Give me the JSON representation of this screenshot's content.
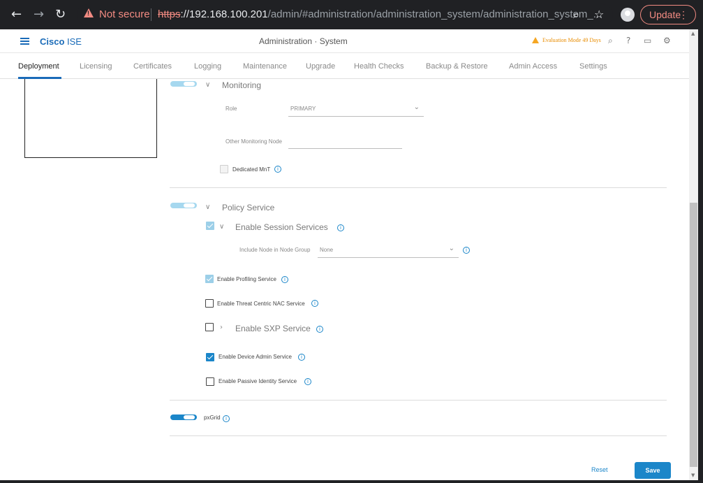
{
  "browser": {
    "not_secure": "Not secure",
    "url_scheme": "https",
    "url_host": "://192.168.100.201",
    "url_path": "/admin/#administration/administration_system/administration_system_...",
    "update_label": "Update",
    "icons": [
      "back-arrow",
      "forward-arrow",
      "reload",
      "zoom",
      "star",
      "profile",
      "more-vertical"
    ]
  },
  "header": {
    "brand_bold": "Cisco",
    "brand_rest": " ISE",
    "title": "Administration · System",
    "evaluation": "Evaluation Mode 49 Days",
    "icons": [
      "search-icon",
      "help-icon",
      "dashboard-icon",
      "settings-icon"
    ]
  },
  "tabs": [
    {
      "label": "Deployment",
      "active": true
    },
    {
      "label": "Licensing"
    },
    {
      "label": "Certificates"
    },
    {
      "label": "Logging"
    },
    {
      "label": "Maintenance"
    },
    {
      "label": "Upgrade"
    },
    {
      "label": "Health Checks"
    },
    {
      "label": "Backup & Restore"
    },
    {
      "label": "Admin Access"
    },
    {
      "label": "Settings"
    }
  ],
  "monitoring": {
    "title": "Monitoring",
    "role_label": "Role",
    "role_value": "PRIMARY",
    "other_node_label": "Other Monitoring Node",
    "other_node_value": "",
    "dedicated_label": "Dedicated MnT"
  },
  "policy": {
    "title": "Policy Service",
    "session_title": "Enable Session Services",
    "node_group_label": "Include Node in Node Group",
    "node_group_value": "None",
    "profiling_label": "Enable Profiling Service",
    "threat_label": "Enable Threat Centric NAC Service",
    "sxp_title": "Enable SXP Service",
    "device_admin_label": "Enable Device Admin Service",
    "passive_label": "Enable Passive Identity Service"
  },
  "pxgrid": {
    "label": "pxGrid"
  },
  "footer": {
    "reset": "Reset",
    "save": "Save"
  },
  "colors": {
    "accent": "#1b86c9",
    "brand": "#1a6bb8",
    "warning": "#f5a623",
    "chrome": "#202124"
  }
}
